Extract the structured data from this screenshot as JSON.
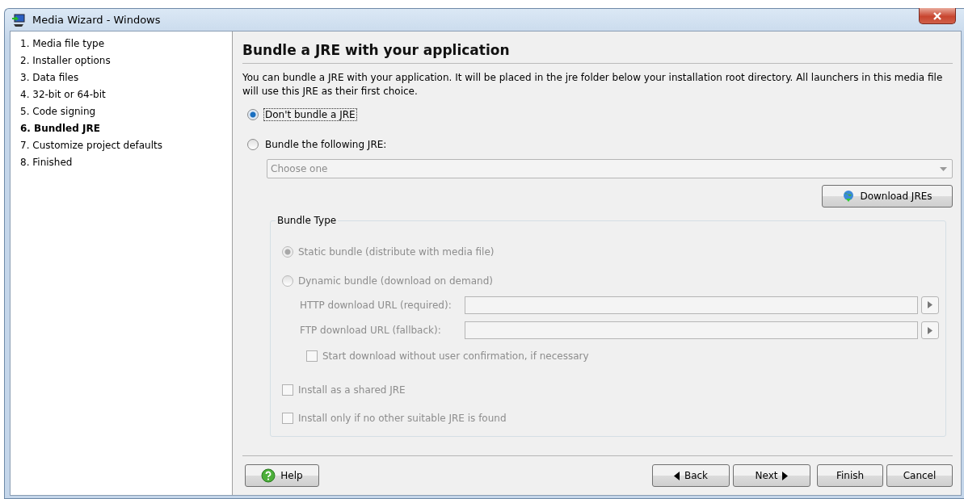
{
  "window": {
    "title": "Media Wizard - Windows"
  },
  "steps": [
    {
      "label": "1. Media file type",
      "selected": false
    },
    {
      "label": "2. Installer options",
      "selected": false
    },
    {
      "label": "3. Data files",
      "selected": false
    },
    {
      "label": "4. 32-bit or 64-bit",
      "selected": false
    },
    {
      "label": "5. Code signing",
      "selected": false
    },
    {
      "label": "6. Bundled JRE",
      "selected": true
    },
    {
      "label": "7. Customize project defaults",
      "selected": false
    },
    {
      "label": "8. Finished",
      "selected": false
    }
  ],
  "heading": "Bundle a JRE with your application",
  "description": "You can bundle a JRE with your application. It will be placed in the jre folder below your installation root directory. All launchers in this media file will use this JRE as their first choice.",
  "options": [
    {
      "label": "Don't bundle a JRE",
      "selected": true
    },
    {
      "label": "Bundle the following JRE:",
      "selected": false
    }
  ],
  "jre_select": {
    "placeholder": "Choose one",
    "disabled": true
  },
  "download_button": "Download JREs",
  "bundle_type": {
    "title": "Bundle Type",
    "options": [
      {
        "label": "Static bundle (distribute with media file)",
        "selected": true,
        "disabled": true
      },
      {
        "label": "Dynamic bundle (download on demand)",
        "selected": false,
        "disabled": true
      }
    ],
    "url_fields": [
      {
        "label": "HTTP download URL (required):",
        "disabled": true
      },
      {
        "label": "FTP download URL (fallback):",
        "disabled": true
      }
    ],
    "start_download": {
      "label": "Start download without user confirmation, if necessary",
      "checked": false,
      "disabled": true
    },
    "checkboxes": [
      {
        "label": "Install as a shared JRE",
        "checked": false,
        "disabled": true
      },
      {
        "label": "Install only if no other suitable JRE is found",
        "checked": false,
        "disabled": true
      }
    ]
  },
  "buttons": {
    "help": "Help",
    "back": "Back",
    "next": "Next",
    "finish": "Finish",
    "cancel": "Cancel"
  }
}
